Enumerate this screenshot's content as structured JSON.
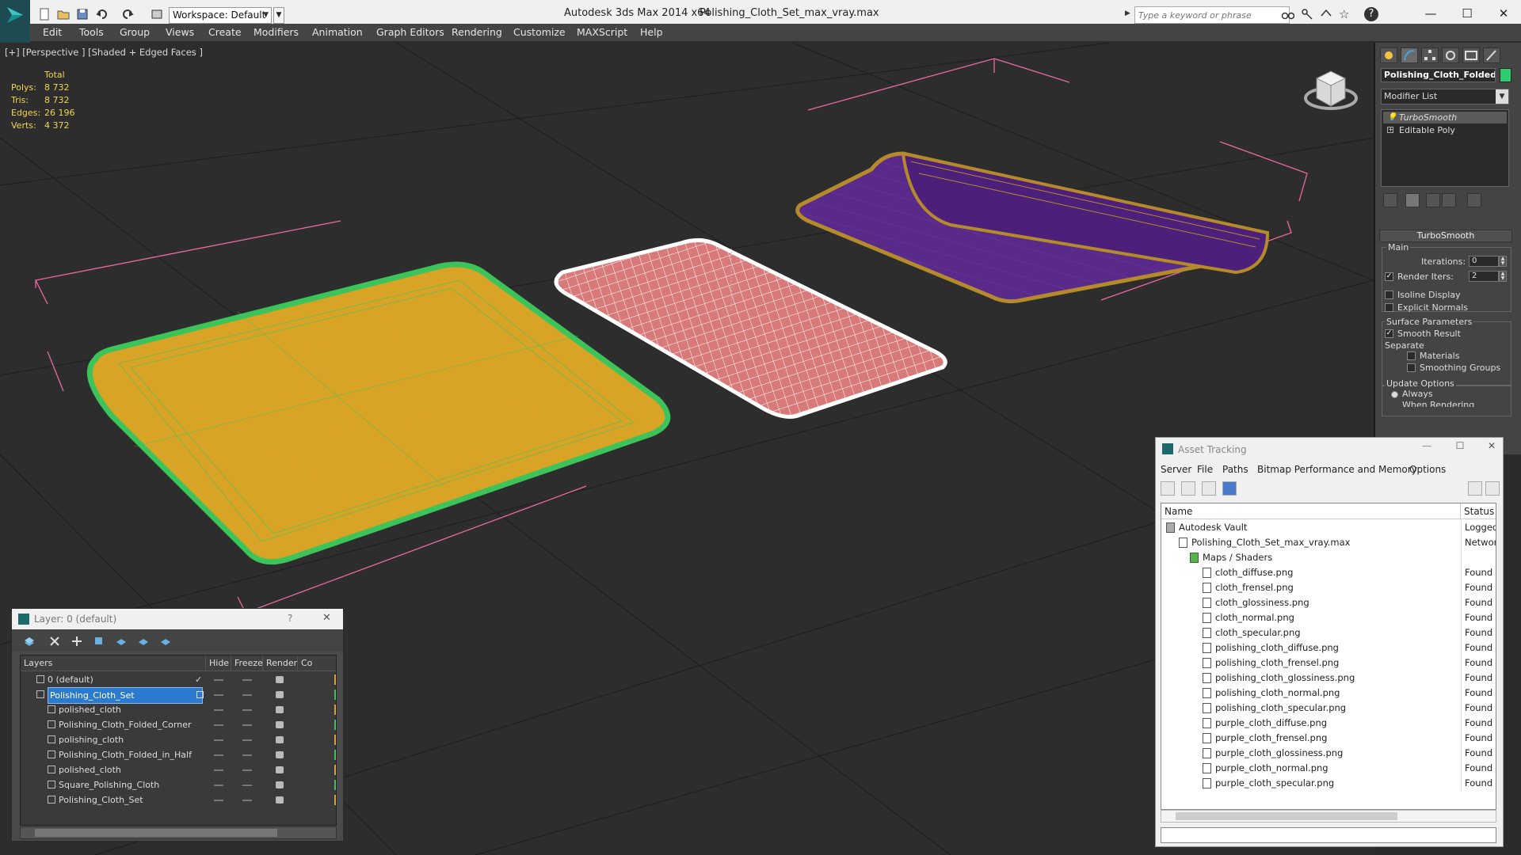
{
  "titlebar": {
    "workspace": "Workspace: Default",
    "app_title": "Autodesk 3ds Max  2014 x64",
    "file_title": "Polishing_Cloth_Set_max_vray.max",
    "search_placeholder": "Type a keyword or phrase"
  },
  "menu": [
    "Edit",
    "Tools",
    "Group",
    "Views",
    "Create",
    "Modifiers",
    "Animation",
    "Graph Editors",
    "Rendering",
    "Customize",
    "MAXScript",
    "Help"
  ],
  "viewport": {
    "label": "[+] [Perspective ] [Shaded + Edged Faces ]",
    "stats_header": "Total",
    "stats": [
      {
        "label": "Polys:",
        "value": "8 732"
      },
      {
        "label": "Tris:",
        "value": "8 732"
      },
      {
        "label": "Edges:",
        "value": "26 196"
      },
      {
        "label": "Verts:",
        "value": "4 372"
      }
    ]
  },
  "command_panel": {
    "object_name": "Polishing_Cloth_Folded_i",
    "object_color": "#2ecc71",
    "modifier_list": "Modifier List",
    "stack": [
      "TurboSmooth",
      "Editable Poly"
    ],
    "rollout_title": "TurboSmooth",
    "main_label": "Main",
    "iterations_label": "Iterations:",
    "iterations_value": "0",
    "render_iters_label": "Render Iters:",
    "render_iters_value": "2",
    "isoline": "Isoline Display",
    "explicit_normals": "Explicit Normals",
    "surface_params": "Surface Parameters",
    "smooth_result": "Smooth Result",
    "separate": "Separate",
    "materials": "Materials",
    "smoothing_groups": "Smoothing Groups",
    "update_options": "Update Options",
    "always": "Always",
    "when_rendering": "When Rendering"
  },
  "asset_tracking": {
    "title": "Asset Tracking",
    "menu": [
      "Server",
      "File",
      "Paths",
      "Bitmap Performance and Memory",
      "Options"
    ],
    "col_name": "Name",
    "col_status": "Status",
    "rows": [
      {
        "name": "Autodesk Vault",
        "status": "Logged Ou",
        "indent": 0
      },
      {
        "name": "Polishing_Cloth_Set_max_vray.max",
        "status": "Network Pa",
        "indent": 1
      },
      {
        "name": "Maps / Shaders",
        "status": "",
        "indent": 2
      },
      {
        "name": "cloth_diffuse.png",
        "status": "Found",
        "indent": 3
      },
      {
        "name": "cloth_frensel.png",
        "status": "Found",
        "indent": 3
      },
      {
        "name": "cloth_glossiness.png",
        "status": "Found",
        "indent": 3
      },
      {
        "name": "cloth_normal.png",
        "status": "Found",
        "indent": 3
      },
      {
        "name": "cloth_specular.png",
        "status": "Found",
        "indent": 3
      },
      {
        "name": "polishing_cloth_diffuse.png",
        "status": "Found",
        "indent": 3
      },
      {
        "name": "polishing_cloth_frensel.png",
        "status": "Found",
        "indent": 3
      },
      {
        "name": "polishing_cloth_glossiness.png",
        "status": "Found",
        "indent": 3
      },
      {
        "name": "polishing_cloth_normal.png",
        "status": "Found",
        "indent": 3
      },
      {
        "name": "polishing_cloth_specular.png",
        "status": "Found",
        "indent": 3
      },
      {
        "name": "purple_cloth_diffuse.png",
        "status": "Found",
        "indent": 3
      },
      {
        "name": "purple_cloth_frensel.png",
        "status": "Found",
        "indent": 3
      },
      {
        "name": "purple_cloth_glossiness.png",
        "status": "Found",
        "indent": 3
      },
      {
        "name": "purple_cloth_normal.png",
        "status": "Found",
        "indent": 3
      },
      {
        "name": "purple_cloth_specular.png",
        "status": "Found",
        "indent": 3
      }
    ]
  },
  "layers": {
    "title": "Layer: 0 (default)",
    "help": "?",
    "columns": [
      "Layers",
      "Hide",
      "Freeze",
      "Render",
      "Co"
    ],
    "rows": [
      {
        "name": "0 (default)",
        "indent": 1
      },
      {
        "name": "Polishing_Cloth_Set",
        "indent": 1,
        "selected": true
      },
      {
        "name": "polished_cloth",
        "indent": 2
      },
      {
        "name": "Polishing_Cloth_Folded_Corner",
        "indent": 2
      },
      {
        "name": "polishing_cloth",
        "indent": 2
      },
      {
        "name": "Polishing_Cloth_Folded_in_Half",
        "indent": 2
      },
      {
        "name": "polished_cloth",
        "indent": 2
      },
      {
        "name": "Square_Polishing_Cloth",
        "indent": 2
      },
      {
        "name": "Polishing_Cloth_Set",
        "indent": 2
      }
    ]
  },
  "colors": {
    "yellow_cloth": "#d9a326",
    "green_edge": "#3cc45a",
    "pink_cloth": "#d97a7a",
    "purple_cloth": "#5a2a8a",
    "gold_edge": "#b48a2a"
  }
}
